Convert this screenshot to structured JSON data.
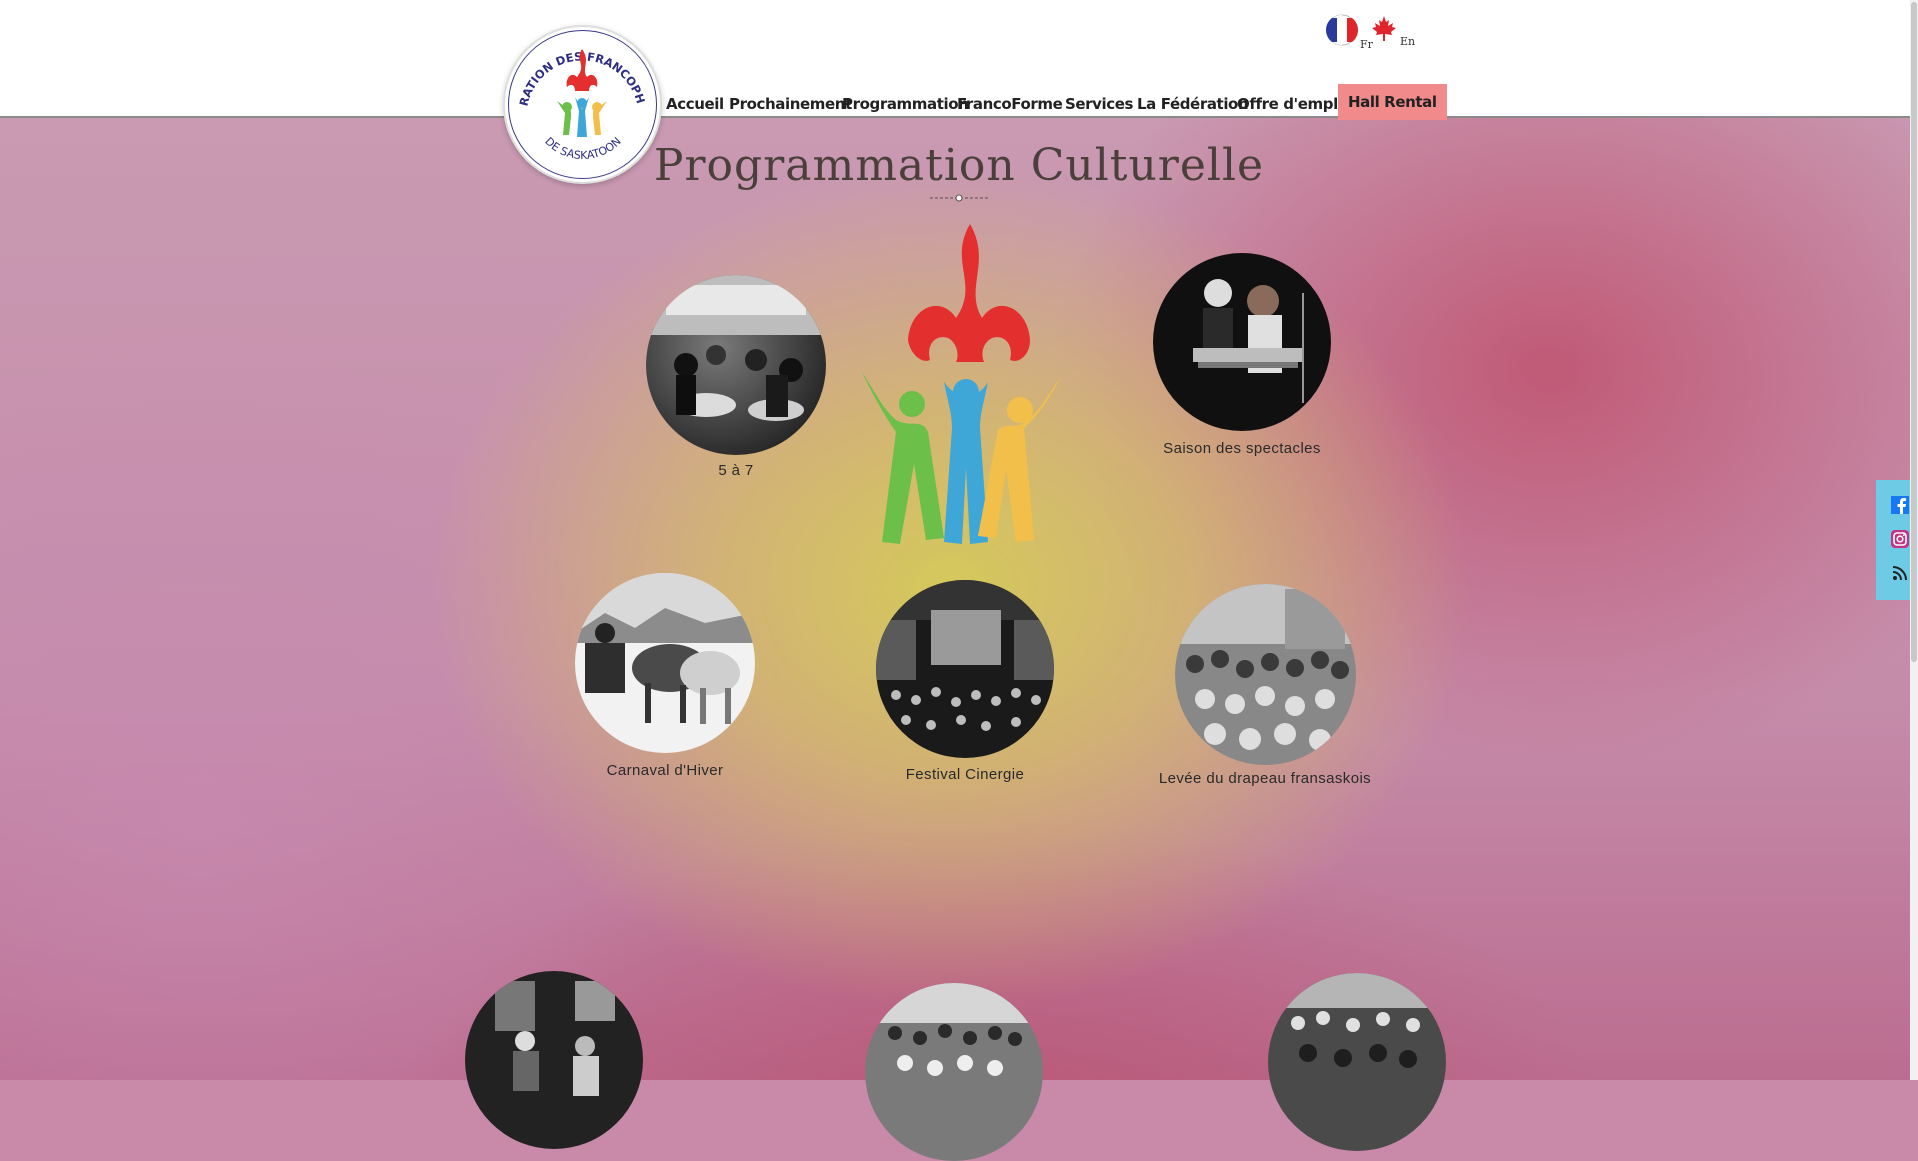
{
  "colors": {
    "accent": "#f18a8a",
    "title_text": "#4a3f3a",
    "social_bar": "#6ecbe6",
    "flame_red": "#e42f2f",
    "figure_green": "#6cc04a",
    "figure_blue": "#3fa6d8",
    "figure_yellow": "#f2c04a"
  },
  "logo": {
    "top_text": "FÉDÉRATION DES FRANCOPHONES",
    "bottom_text": "DE SASKATOON"
  },
  "language": {
    "fr_label": "Fr",
    "en_label": "En"
  },
  "nav": {
    "items": [
      {
        "label": "Accueil"
      },
      {
        "label": "Prochainement"
      },
      {
        "label": "Programmation"
      },
      {
        "label": "FrancoForme"
      },
      {
        "label": "Services"
      },
      {
        "label": "La Fédération"
      },
      {
        "label": "Offre d'emploi"
      },
      {
        "label": "Hall Rental"
      }
    ]
  },
  "page_title": "Programmation Culturelle",
  "programs": [
    {
      "caption": "5 à 7",
      "photo": "crowd-at-tables-photo"
    },
    {
      "caption": "Saison des spectacles",
      "photo": "musicians-at-keyboard-photo"
    },
    {
      "caption": "Carnaval d'Hiver",
      "photo": "horse-sleigh-photo"
    },
    {
      "caption": "Festival Cinergie",
      "photo": "cinema-audience-photo"
    },
    {
      "caption": "Levée du drapeau fransaskois",
      "photo": "flag-raising-crowd-photo"
    },
    {
      "caption": "",
      "photo": "indoor-group-photo"
    },
    {
      "caption": "",
      "photo": "outdoor-crowd-photo"
    },
    {
      "caption": "",
      "photo": "gym-crowd-photo"
    }
  ],
  "social": {
    "icons": [
      "facebook-icon",
      "instagram-icon",
      "rss-icon"
    ]
  }
}
